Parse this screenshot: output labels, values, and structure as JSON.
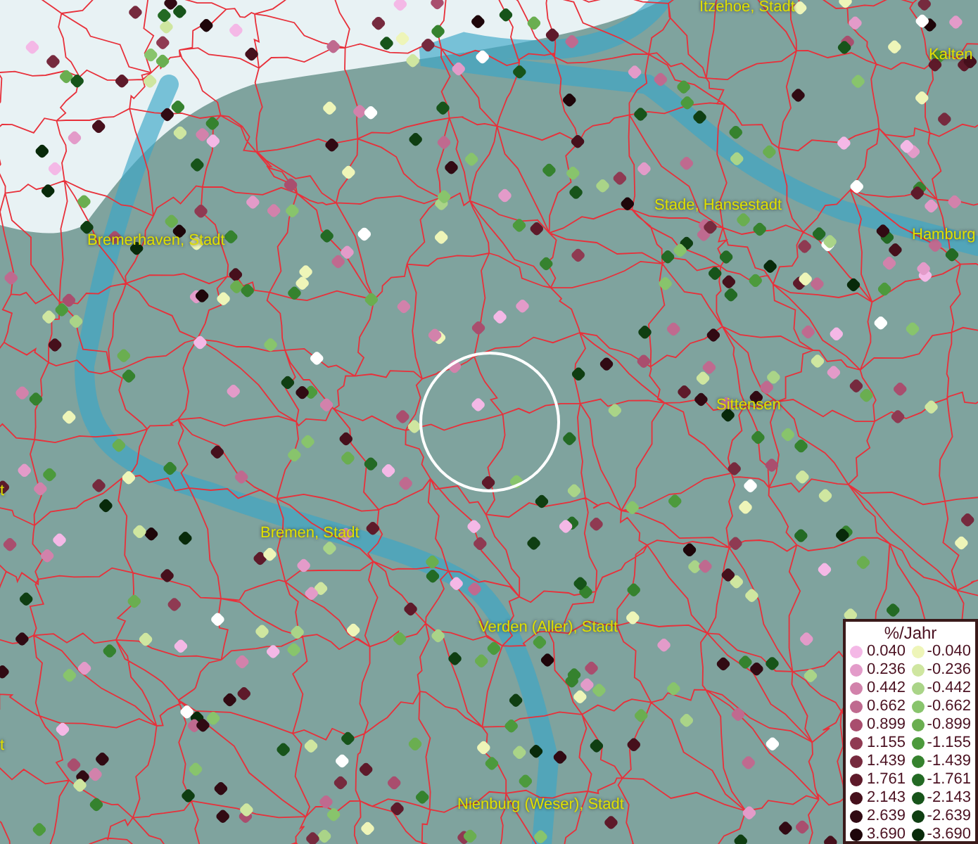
{
  "map": {
    "places": [
      {
        "name": "Itzehoe, Stadt"
      },
      {
        "name": "Kalten"
      },
      {
        "name": "Stade, Hansestadt"
      },
      {
        "name": "Hamburg"
      },
      {
        "name": "Bremerhaven, Stadt"
      },
      {
        "name": "Sittensen"
      },
      {
        "name": "t"
      },
      {
        "name": "Bremen, Stadt"
      },
      {
        "name": "Verden (Aller), Stadt"
      },
      {
        "name": "t"
      },
      {
        "name": "Nienburg (Weser), Stadt"
      }
    ]
  },
  "legend": {
    "title": "%/Jahr",
    "rows": [
      {
        "positive": {
          "label": "0.040",
          "color": "#f4b8e6"
        },
        "negative": {
          "label": "-0.040",
          "color": "#eef5b8"
        }
      },
      {
        "positive": {
          "label": "0.236",
          "color": "#e39bc9"
        },
        "negative": {
          "label": "-0.236",
          "color": "#cfe6a0"
        }
      },
      {
        "positive": {
          "label": "0.442",
          "color": "#d282ab"
        },
        "negative": {
          "label": "-0.442",
          "color": "#aad488"
        }
      },
      {
        "positive": {
          "label": "0.662",
          "color": "#bf6a8f"
        },
        "negative": {
          "label": "-0.662",
          "color": "#88c46c"
        }
      },
      {
        "positive": {
          "label": "0.899",
          "color": "#a94e6e"
        },
        "negative": {
          "label": "-0.899",
          "color": "#6aae50"
        }
      },
      {
        "positive": {
          "label": "1.155",
          "color": "#8f3a52"
        },
        "negative": {
          "label": "-1.155",
          "color": "#4c9a3c"
        }
      },
      {
        "positive": {
          "label": "1.439",
          "color": "#762a3e"
        },
        "negative": {
          "label": "-1.439",
          "color": "#35822e"
        }
      },
      {
        "positive": {
          "label": "1.761",
          "color": "#5e1a2a"
        },
        "negative": {
          "label": "-1.761",
          "color": "#236a24"
        }
      },
      {
        "positive": {
          "label": "2.143",
          "color": "#46101c"
        },
        "negative": {
          "label": "-2.143",
          "color": "#17541a"
        }
      },
      {
        "positive": {
          "label": "2.639",
          "color": "#310a13"
        },
        "negative": {
          "label": "-2.639",
          "color": "#0f3e12"
        }
      },
      {
        "positive": {
          "label": "3.690",
          "color": "#1e060a"
        },
        "negative": {
          "label": "-3.690",
          "color": "#082a0a"
        }
      }
    ]
  }
}
